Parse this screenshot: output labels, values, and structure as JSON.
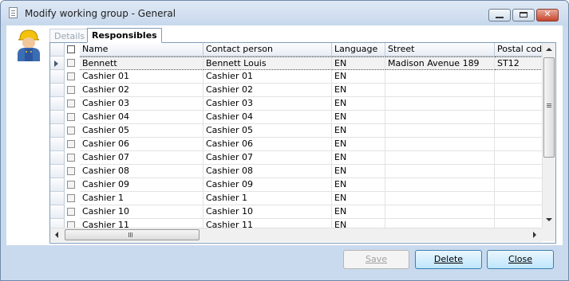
{
  "window": {
    "title": "Modify working group - General"
  },
  "tabs": [
    {
      "label": "Details",
      "active": false
    },
    {
      "label": "Responsibles",
      "active": true
    }
  ],
  "grid": {
    "columns": [
      "Name",
      "Contact person",
      "Language",
      "Street",
      "Postal code"
    ],
    "rows": [
      {
        "name": "Bennett",
        "contact": "Bennett Louis",
        "language": "EN",
        "street": "Madison Avenue  189",
        "postal": "ST12",
        "current": true
      },
      {
        "name": "Cashier 01",
        "contact": "Cashier 01",
        "language": "EN",
        "street": "",
        "postal": ""
      },
      {
        "name": "Cashier 02",
        "contact": "Cashier 02",
        "language": "EN",
        "street": "",
        "postal": ""
      },
      {
        "name": "Cashier 03",
        "contact": "Cashier 03",
        "language": "EN",
        "street": "",
        "postal": ""
      },
      {
        "name": "Cashier 04",
        "contact": "Cashier 04",
        "language": "EN",
        "street": "",
        "postal": ""
      },
      {
        "name": "Cashier 05",
        "contact": "Cashier 05",
        "language": "EN",
        "street": "",
        "postal": ""
      },
      {
        "name": "Cashier 06",
        "contact": "Cashier 06",
        "language": "EN",
        "street": "",
        "postal": ""
      },
      {
        "name": "Cashier 07",
        "contact": "Cashier 07",
        "language": "EN",
        "street": "",
        "postal": ""
      },
      {
        "name": "Cashier 08",
        "contact": "Cashier 08",
        "language": "EN",
        "street": "",
        "postal": ""
      },
      {
        "name": "Cashier 09",
        "contact": "Cashier 09",
        "language": "EN",
        "street": "",
        "postal": ""
      },
      {
        "name": "Cashier 1",
        "contact": "Cashier 1",
        "language": "EN",
        "street": "",
        "postal": ""
      },
      {
        "name": "Cashier 10",
        "contact": "Cashier 10",
        "language": "EN",
        "street": "",
        "postal": ""
      },
      {
        "name": "Cashier 11",
        "contact": "Cashier 11",
        "language": "EN",
        "street": "",
        "postal": ""
      }
    ]
  },
  "buttons": {
    "save": {
      "label": "Save",
      "enabled": false
    },
    "delete": {
      "label": "Delete",
      "enabled": true
    },
    "close": {
      "label": "Close",
      "enabled": true
    }
  },
  "icons": {
    "title": "document-icon",
    "avatar": "worker-avatar-icon"
  },
  "colors": {
    "window_frame": "#c9daee",
    "button_hover": "#bee6fd",
    "close_button": "#c6452c"
  }
}
